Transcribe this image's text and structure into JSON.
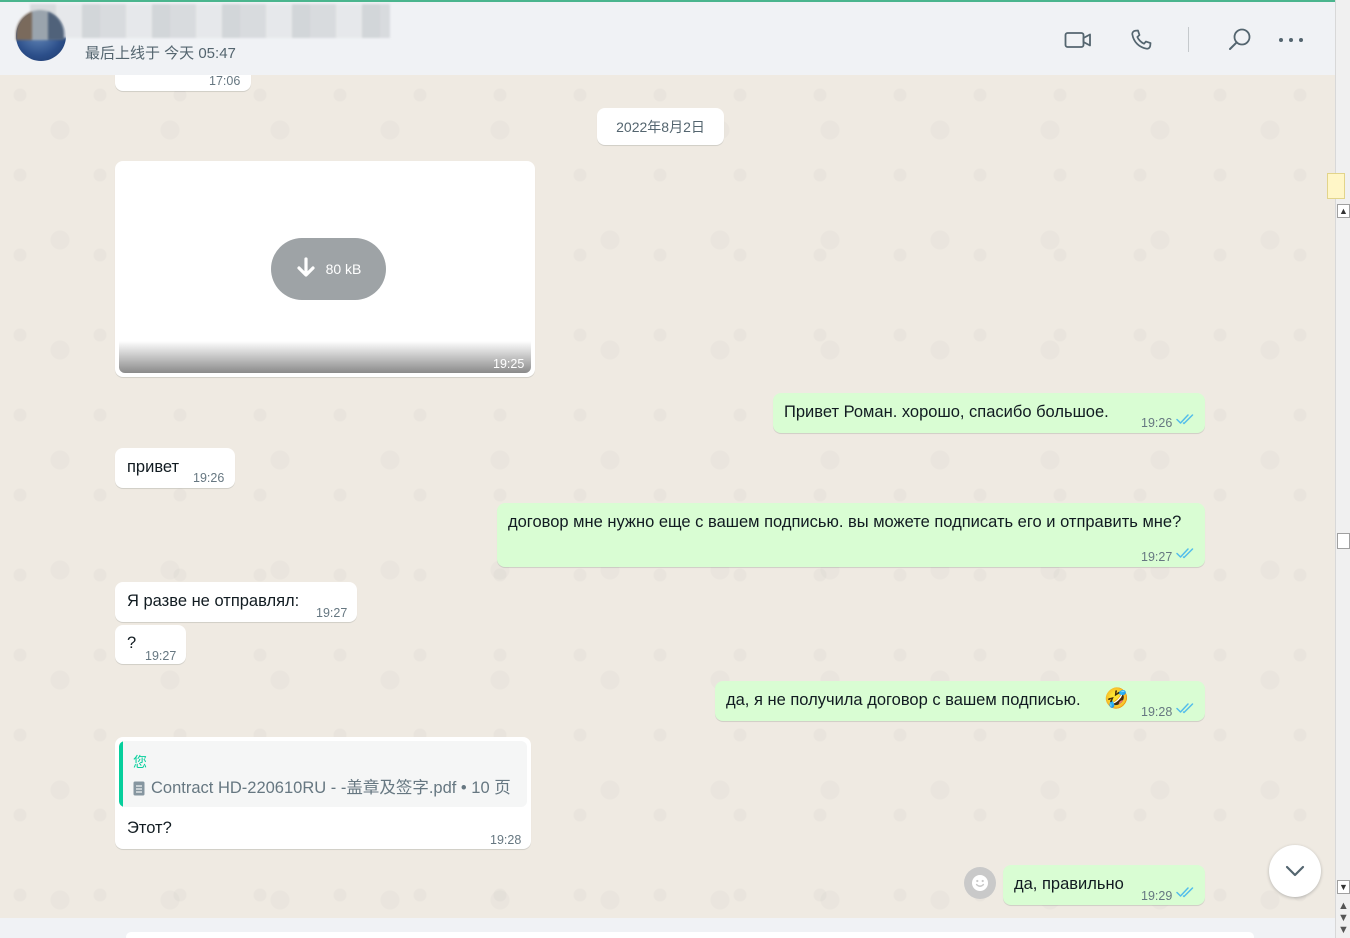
{
  "header": {
    "status": "最后上线于 今天 05:47",
    "icons": [
      "video-call-icon",
      "voice-call-icon",
      "search-icon",
      "more-menu-icon"
    ]
  },
  "chat": {
    "prev_time": "17:06",
    "date_chip": "2022年8月2日",
    "media": {
      "size": "80 kB",
      "time": "19:25"
    },
    "messages": [
      {
        "dir": "out",
        "text": "Привет Роман. хорошо, спасибо большое.",
        "time": "19:26"
      },
      {
        "dir": "in",
        "text": "привет",
        "time": "19:26"
      },
      {
        "dir": "out",
        "text": "договор мне нужно еще с вашем подписью. вы можете подписать его и отправить мне?",
        "time": "19:27"
      },
      {
        "dir": "in",
        "text": "Я разве не отправлял:",
        "time": "19:27"
      },
      {
        "dir": "in",
        "text": "?",
        "time": "19:27"
      },
      {
        "dir": "out",
        "text": "да, я не получила договор с вашем подписью.",
        "emoji": "🤣",
        "time": "19:28"
      },
      {
        "dir": "in",
        "quote_author": "您",
        "quote_file": "Contract HD-220610RU - -盖章及签字.pdf • 10 页",
        "text": "Этот?",
        "time": "19:28"
      },
      {
        "dir": "out",
        "text": "да, правильно",
        "time": "19:29"
      }
    ]
  },
  "colors": {
    "outgoing_bubble": "#d9fdd3",
    "incoming_bubble": "#ffffff",
    "chat_background": "#efeae2",
    "read_ticks": "#53bdeb",
    "accent": "#06cf9c"
  }
}
